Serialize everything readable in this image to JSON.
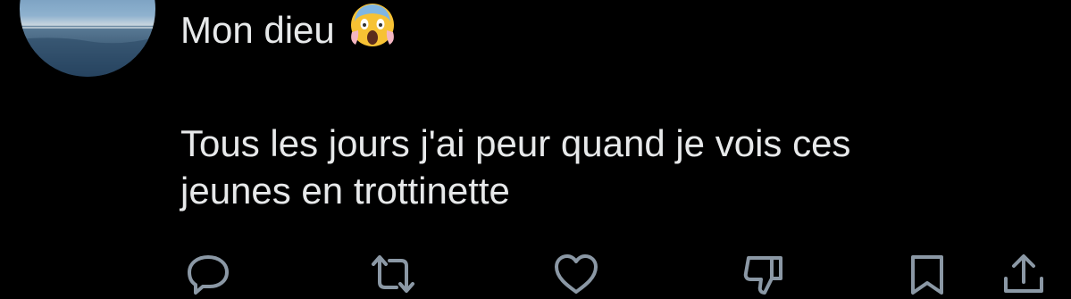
{
  "tweet": {
    "line1": "Mon dieu",
    "line2": "Tous les jours j'ai peur quand je vois ces",
    "line3": "jeunes en trottinette",
    "emoji": "face-screaming-in-fear"
  },
  "avatar": {
    "icon": "profile-photo-sea"
  },
  "actions": [
    {
      "name": "reply",
      "icon": "speech-bubble-icon"
    },
    {
      "name": "retweet",
      "icon": "retweet-icon"
    },
    {
      "name": "like",
      "icon": "heart-icon"
    },
    {
      "name": "dislike",
      "icon": "thumbs-down-icon"
    },
    {
      "name": "bookmark",
      "icon": "bookmark-icon"
    },
    {
      "name": "share",
      "icon": "share-icon"
    }
  ],
  "colors": {
    "background": "#000000",
    "text": "#e7e9ea",
    "icon": "#8b98a5"
  }
}
